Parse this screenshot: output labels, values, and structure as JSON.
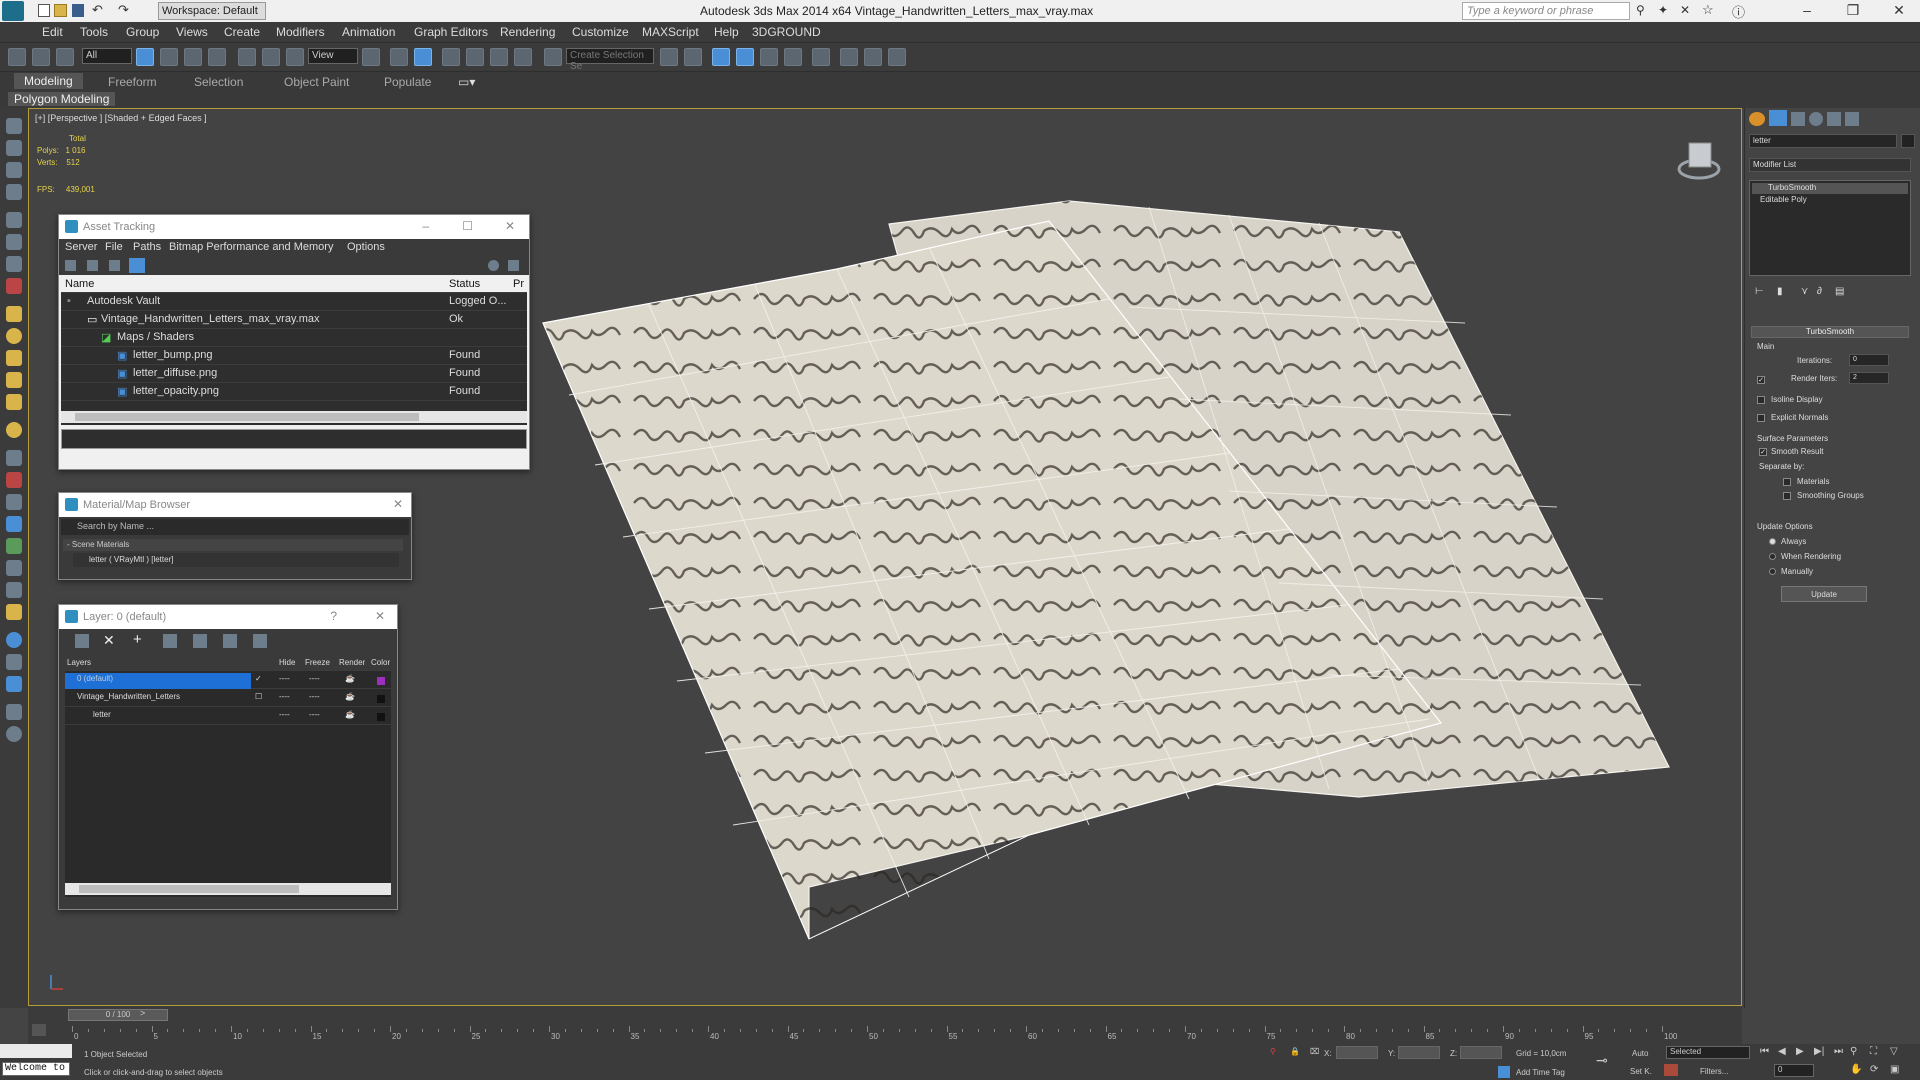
{
  "titlebar": {
    "workspace": "Workspace: Default",
    "app_title": "Autodesk 3ds Max  2014 x64    Vintage_Handwritten_Letters_max_vray.max",
    "search_placeholder": "Type a keyword or phrase"
  },
  "menu": [
    "Edit",
    "Tools",
    "Group",
    "Views",
    "Create",
    "Modifiers",
    "Animation",
    "Graph Editors",
    "Rendering",
    "Customize",
    "MAXScript",
    "Help",
    "3DGROUND"
  ],
  "toolbar": {
    "selection_filter": "All",
    "ref_coord": "View",
    "named_selection": "Create Selection Se"
  },
  "ribbon": {
    "tabs": [
      "Modeling",
      "Freeform",
      "Selection",
      "Object Paint",
      "Populate"
    ],
    "active_tab": "Modeling",
    "panel": "Polygon Modeling"
  },
  "viewport": {
    "label": "[+] [Perspective ] [Shaded + Edged Faces ]",
    "stats_header": "Total",
    "polys_label": "Polys:",
    "polys_value": "1 016",
    "verts_label": "Verts:",
    "verts_value": "512",
    "fps_label": "FPS:",
    "fps_value": "439,001"
  },
  "asset_tracking": {
    "title": "Asset Tracking",
    "menu": [
      "Server",
      "File",
      "Paths",
      "Bitmap Performance and Memory",
      "Options"
    ],
    "columns": [
      "Name",
      "Status",
      "Pr"
    ],
    "rows": [
      {
        "name": "Autodesk Vault",
        "status": "Logged O..."
      },
      {
        "name": "Vintage_Handwritten_Letters_max_vray.max",
        "status": "Ok"
      },
      {
        "name": "Maps / Shaders",
        "status": ""
      },
      {
        "name": "letter_bump.png",
        "status": "Found"
      },
      {
        "name": "letter_diffuse.png",
        "status": "Found"
      },
      {
        "name": "letter_opacity.png",
        "status": "Found"
      }
    ]
  },
  "material_browser": {
    "title": "Material/Map Browser",
    "search_placeholder": "Search by Name ...",
    "group": "- Scene Materials",
    "item": "letter  ( VRayMtl ) [letter]"
  },
  "layer_manager": {
    "title": "Layer: 0 (default)",
    "help": "?",
    "columns": [
      "Layers",
      "Hide",
      "Freeze",
      "Render",
      "Color"
    ],
    "rows": [
      {
        "name": "0 (default)",
        "hide": "----",
        "freeze": "----",
        "color": "#9b2fbf"
      },
      {
        "name": "Vintage_Handwritten_Letters",
        "hide": "----",
        "freeze": "----",
        "color": "#111111"
      },
      {
        "name": "letter",
        "hide": "----",
        "freeze": "----",
        "color": "#111111"
      }
    ]
  },
  "command_panel": {
    "object_name": "letter",
    "modifier_list": "Modifier List",
    "stack": [
      "TurboSmooth",
      "Editable Poly"
    ],
    "turbosmooth": {
      "title": "TurboSmooth",
      "main_label": "Main",
      "iterations_label": "Iterations:",
      "iterations": "0",
      "render_iters_label": "Render Iters:",
      "render_iters": "2",
      "isoline_label": "Isoline Display",
      "explicit_label": "Explicit Normals",
      "surface_label": "Surface Parameters",
      "smooth_result_label": "Smooth Result",
      "separate_by_label": "Separate by:",
      "materials_label": "Materials",
      "smoothing_groups_label": "Smoothing Groups",
      "update_options_label": "Update Options",
      "always_label": "Always",
      "when_rendering_label": "When Rendering",
      "manually_label": "Manually",
      "update_button": "Update"
    }
  },
  "timeline": {
    "slider": "0 / 100",
    "ticks": [
      "0",
      "5",
      "10",
      "15",
      "20",
      "25",
      "30",
      "35",
      "40",
      "45",
      "50",
      "55",
      "60",
      "65",
      "70",
      "75",
      "80",
      "85",
      "90",
      "95",
      "100"
    ]
  },
  "statusbar": {
    "maxscript": "Welcome to",
    "selected": "1 Object Selected",
    "prompt": "Click or click-and-drag to select objects",
    "x_label": "X:",
    "y_label": "Y:",
    "z_label": "Z:",
    "grid": "Grid = 10,0cm",
    "add_time_tag": "Add Time Tag",
    "auto": "Auto",
    "selected_dd": "Selected",
    "setk": "Set K.",
    "filters": "Filters...",
    "frame": "0"
  }
}
